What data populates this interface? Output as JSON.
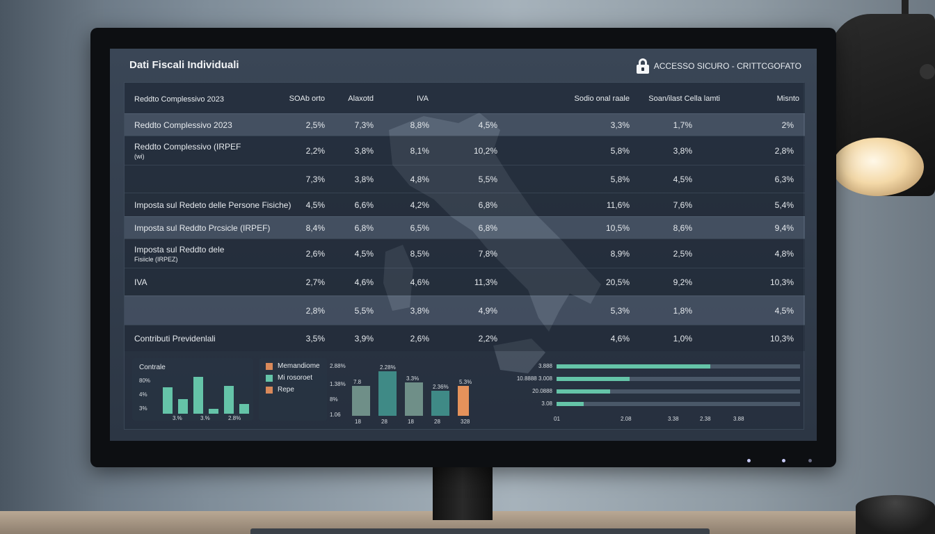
{
  "app": {
    "title": "Dati Fiscali Individuali",
    "secure_label": "ACCESSO SICURO - CRITTCGOFATO",
    "lock_icon": "lock-icon"
  },
  "table": {
    "headers": [
      "Reddto Complessivo 2023",
      "SOAb orto",
      "Alaxotd",
      "IVA",
      "",
      "Sodio onal raale",
      "Soan/ilast Cella lamti",
      "Misnto"
    ],
    "rows": [
      {
        "label": [
          "Reddto Complessivo 2023"
        ],
        "values": [
          "2,5%",
          "7,3%",
          "8,8%",
          "4,5%",
          "3,3%",
          "1,7%",
          "2%"
        ],
        "style": "alt"
      },
      {
        "label": [
          "Reddto Complessivo (IRPEF",
          "(wi)"
        ],
        "values": [
          "2,2%",
          "3,8%",
          "8,1%",
          "10,2%",
          "5,8%",
          "3,8%",
          "2,8%"
        ],
        "style": "dark"
      },
      {
        "label": [
          ""
        ],
        "values": [
          "7,3%",
          "3,8%",
          "4,8%",
          "5,5%",
          "5,8%",
          "4,5%",
          "6,3%"
        ],
        "style": "dark"
      },
      {
        "label": [
          "Imposta sul Redeto delle Persone Fisiche)"
        ],
        "values": [
          "4,5%",
          "6,6%",
          "4,2%",
          "6,8%",
          "11,6%",
          "7,6%",
          "5,4%"
        ],
        "style": "dark"
      },
      {
        "label": [
          "Imposta sul Reddto Prcsicle (IRPEF)"
        ],
        "values": [
          "8,4%",
          "6,8%",
          "6,5%",
          "6,8%",
          "10,5%",
          "8,6%",
          "9,4%"
        ],
        "style": "alt"
      },
      {
        "label": [
          "Imposta sul Reddto dele",
          "Fisiicle (IRPEZ)"
        ],
        "values": [
          "2,6%",
          "4,5%",
          "8,5%",
          "7,8%",
          "8,9%",
          "2,5%",
          "4,8%"
        ],
        "style": "dark"
      },
      {
        "label": [
          "IVA"
        ],
        "values": [
          "2,7%",
          "4,6%",
          "4,6%",
          "11,3%",
          "20,5%",
          "9,2%",
          "10,3%"
        ],
        "style": "dark"
      },
      {
        "label": [
          ""
        ],
        "values": [
          "2,8%",
          "5,5%",
          "3,8%",
          "4,9%",
          "5,3%",
          "1,8%",
          "4,5%"
        ],
        "style": "alt"
      },
      {
        "label": [
          "Contributi Previdenlali"
        ],
        "values": [
          "3,5%",
          "3,9%",
          "2,6%",
          "2,2%",
          "4,6%",
          "1,0%",
          "10,3%"
        ],
        "style": "dark"
      }
    ]
  },
  "chart_data": [
    {
      "type": "bar",
      "title": "Contrale",
      "y_ticks": [
        "80%",
        "4%",
        "3%"
      ],
      "x_ticks": [
        "3.%",
        "3.%",
        "2.8%"
      ],
      "values": [
        0.62,
        0.34,
        0.86,
        0.12,
        0.64,
        0.22
      ],
      "color": "#65c4a8"
    },
    {
      "type": "legend",
      "items": [
        {
          "label": "Memandiome",
          "color": "#d9895a"
        },
        {
          "label": "Mi rosoroet",
          "color": "#65c4a8"
        },
        {
          "label": "Repe",
          "color": "#d9895a"
        }
      ]
    },
    {
      "type": "bar",
      "y_ticks": [
        "2.88%",
        "1.38%",
        "8%",
        "1.06"
      ],
      "x_ticks": [
        "18",
        "28",
        "18",
        "28",
        "328"
      ],
      "data_labels": [
        "7.8",
        "2.28%",
        "3.3%",
        "2.36%",
        "5.3%"
      ],
      "values": [
        0.62,
        0.92,
        0.68,
        0.52,
        0.62
      ],
      "colors": [
        "#6f8f88",
        "#3f8a86",
        "#6f8f88",
        "#3f8a86",
        "#e5925b"
      ]
    },
    {
      "type": "hbar",
      "y_ticks": [
        "3.888",
        "10.8888 3.008",
        "20.0888",
        "3.08"
      ],
      "x_ticks": [
        "01",
        "2.08",
        "3.38",
        "2.38",
        "3.88"
      ],
      "values": [
        0.63,
        0.3,
        0.22,
        0.11
      ],
      "color": "#65c4a8"
    }
  ],
  "status_leds_color": "#c7c9f5"
}
